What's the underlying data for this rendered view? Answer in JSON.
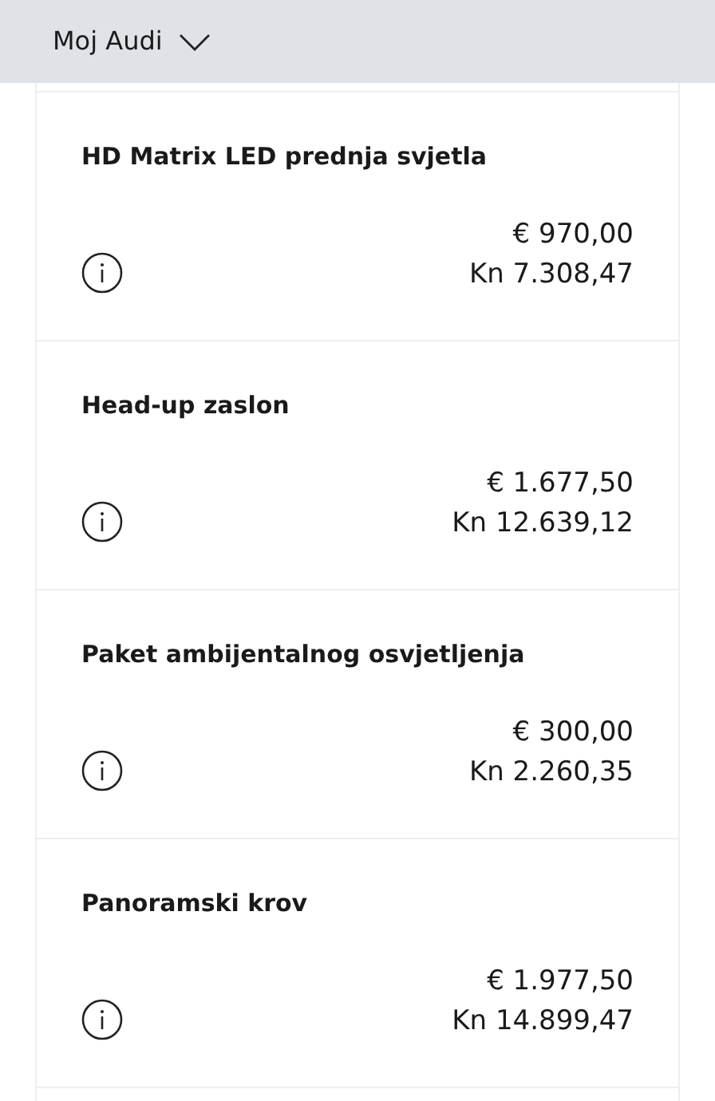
{
  "header": {
    "title": "Moj Audi"
  },
  "items": [
    {
      "name": "HD Matrix LED prednja svjetla",
      "price_eur": "€ 970,00",
      "price_kn": "Kn 7.308,47"
    },
    {
      "name": "Head-up zaslon",
      "price_eur": "€ 1.677,50",
      "price_kn": "Kn 12.639,12"
    },
    {
      "name": "Paket ambijentalnog osvjetljenja",
      "price_eur": "€ 300,00",
      "price_kn": "Kn 2.260,35"
    },
    {
      "name": "Panoramski krov",
      "price_eur": "€ 1.977,50",
      "price_kn": "Kn 14.899,47"
    }
  ]
}
